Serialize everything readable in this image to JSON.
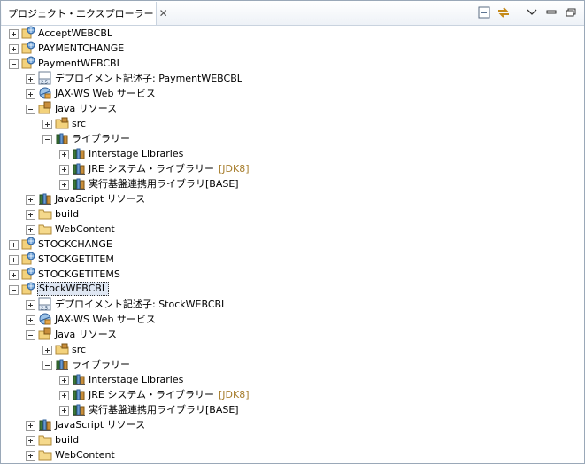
{
  "tab": {
    "title": "プロジェクト・エクスプローラー",
    "close": "✕"
  },
  "tree": [
    {
      "depth": 0,
      "exp": "plus",
      "icon": "project",
      "label": "AcceptWEBCBL"
    },
    {
      "depth": 0,
      "exp": "plus",
      "icon": "project",
      "label": "PAYMENTCHANGE"
    },
    {
      "depth": 0,
      "exp": "minus",
      "icon": "project",
      "label": "PaymentWEBCBL"
    },
    {
      "depth": 1,
      "exp": "plus",
      "icon": "descriptor",
      "label": "デプロイメント記述子: PaymentWEBCBL"
    },
    {
      "depth": 1,
      "exp": "plus",
      "icon": "webservice",
      "label": "JAX-WS Web サービス"
    },
    {
      "depth": 1,
      "exp": "minus",
      "icon": "javares",
      "label": "Java リソース"
    },
    {
      "depth": 2,
      "exp": "plus",
      "icon": "srcfolder",
      "label": "src"
    },
    {
      "depth": 2,
      "exp": "minus",
      "icon": "library",
      "label": "ライブラリー"
    },
    {
      "depth": 3,
      "exp": "plus",
      "icon": "library",
      "label": "Interstage Libraries"
    },
    {
      "depth": 3,
      "exp": "plus",
      "icon": "library",
      "label": "JRE システム・ライブラリー",
      "suffix": "[JDK8]"
    },
    {
      "depth": 3,
      "exp": "plus",
      "icon": "library",
      "label": "実行基盤連携用ライブラリ[BASE]"
    },
    {
      "depth": 1,
      "exp": "plus",
      "icon": "library",
      "label": "JavaScript リソース"
    },
    {
      "depth": 1,
      "exp": "plus",
      "icon": "folder",
      "label": "build"
    },
    {
      "depth": 1,
      "exp": "plus",
      "icon": "folder",
      "label": "WebContent"
    },
    {
      "depth": 0,
      "exp": "plus",
      "icon": "project",
      "label": "STOCKCHANGE"
    },
    {
      "depth": 0,
      "exp": "plus",
      "icon": "project",
      "label": "STOCKGETITEM"
    },
    {
      "depth": 0,
      "exp": "plus",
      "icon": "project",
      "label": "STOCKGETITEMS"
    },
    {
      "depth": 0,
      "exp": "minus",
      "icon": "project",
      "label": "StockWEBCBL",
      "selected": true
    },
    {
      "depth": 1,
      "exp": "plus",
      "icon": "descriptor",
      "label": "デプロイメント記述子: StockWEBCBL"
    },
    {
      "depth": 1,
      "exp": "plus",
      "icon": "webservice",
      "label": "JAX-WS Web サービス"
    },
    {
      "depth": 1,
      "exp": "minus",
      "icon": "javares",
      "label": "Java リソース"
    },
    {
      "depth": 2,
      "exp": "plus",
      "icon": "srcfolder",
      "label": "src"
    },
    {
      "depth": 2,
      "exp": "minus",
      "icon": "library",
      "label": "ライブラリー"
    },
    {
      "depth": 3,
      "exp": "plus",
      "icon": "library",
      "label": "Interstage Libraries"
    },
    {
      "depth": 3,
      "exp": "plus",
      "icon": "library",
      "label": "JRE システム・ライブラリー",
      "suffix": "[JDK8]"
    },
    {
      "depth": 3,
      "exp": "plus",
      "icon": "library",
      "label": "実行基盤連携用ライブラリ[BASE]"
    },
    {
      "depth": 1,
      "exp": "plus",
      "icon": "library",
      "label": "JavaScript リソース"
    },
    {
      "depth": 1,
      "exp": "plus",
      "icon": "folder",
      "label": "build"
    },
    {
      "depth": 1,
      "exp": "plus",
      "icon": "folder",
      "label": "WebContent"
    }
  ],
  "colors": {
    "suffix": "#a67c2a",
    "selection": "#dfe7f3"
  }
}
